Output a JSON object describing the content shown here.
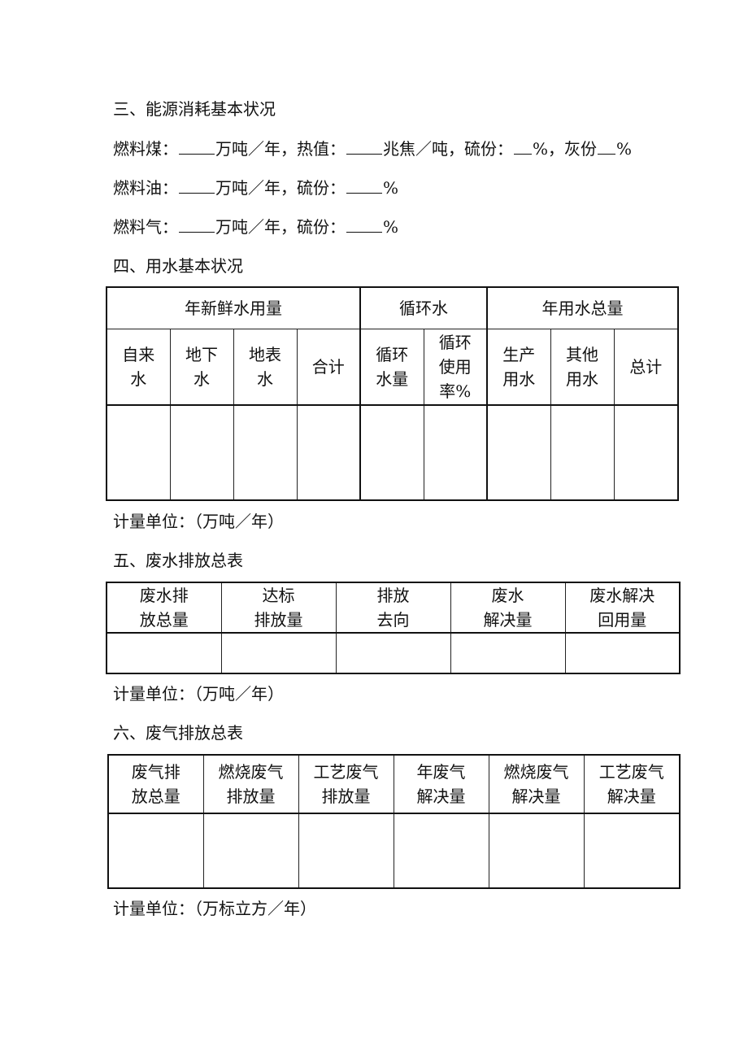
{
  "section3": {
    "title": "三、能源消耗基本状况",
    "coal": {
      "label": "燃料煤：",
      "unit1": "万吨／年，热值：",
      "unit2": "兆焦／吨，硫份：",
      "unit3": "%，灰份",
      "unit4": "%"
    },
    "oil": {
      "label": "燃料油：",
      "unit1": "万吨／年，硫份：",
      "unit2": "%"
    },
    "gas": {
      "label": "燃料气：",
      "unit1": "万吨／年，硫份：",
      "unit2": "%"
    }
  },
  "section4": {
    "title": "四、用水基本状况",
    "groups": [
      "年新鲜水用量",
      "循环水",
      "年用水总量"
    ],
    "columns": [
      [
        "自来",
        "水"
      ],
      [
        "地下",
        "水"
      ],
      [
        "地表",
        "水"
      ],
      [
        "合计"
      ],
      [
        "循环",
        "水量"
      ],
      [
        "循环",
        "使用",
        "率%"
      ],
      [
        "生产",
        "用水"
      ],
      [
        "其他",
        "用水"
      ],
      [
        "总计"
      ]
    ],
    "unit_note": "计量单位：（万吨／年）"
  },
  "section5": {
    "title": "五、废水排放总表",
    "columns": [
      [
        "废水排",
        "放总量"
      ],
      [
        "达标",
        "排放量"
      ],
      [
        "排放",
        "去向"
      ],
      [
        "废水",
        "解决量"
      ],
      [
        "废水解决",
        "回用量"
      ]
    ],
    "unit_note": "计量单位：（万吨／年）"
  },
  "section6": {
    "title": "六、废气排放总表",
    "columns": [
      [
        "废气排",
        "放总量"
      ],
      [
        "燃烧废气",
        "排放量"
      ],
      [
        "工艺废气",
        "排放量"
      ],
      [
        "年废气",
        "解决量"
      ],
      [
        "燃烧废气",
        "解决量"
      ],
      [
        "工艺废气",
        "解决量"
      ]
    ],
    "unit_note": "计量单位：（万标立方／年）"
  }
}
